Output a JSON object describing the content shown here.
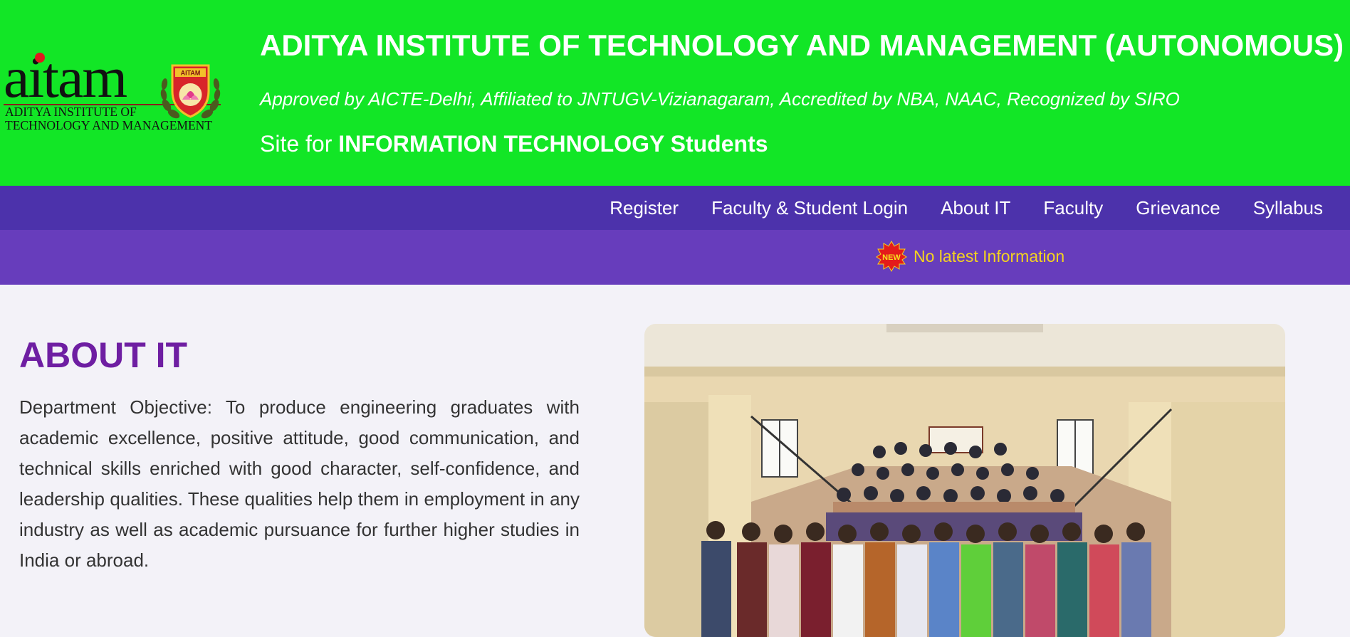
{
  "logo": {
    "wordmark": "aitam",
    "subtitle_line1": "ADITYA INSTITUTE OF",
    "subtitle_line2": "TECHNOLOGY AND MANAGEMENT",
    "emblem_label": "AITAM"
  },
  "header": {
    "title": "ADITYA INSTITUTE OF TECHNOLOGY AND MANAGEMENT (AUTONOMOUS)",
    "approved": "Approved by AICTE-Delhi, Affiliated to JNTUGV-Vizianagaram, Accredited by NBA, NAAC, Recognized by SIRO",
    "site_prefix": "Site for",
    "site_strong": "INFORMATION TECHNOLOGY Students"
  },
  "nav": {
    "items": [
      {
        "label": "Register"
      },
      {
        "label": "Faculty & Student Login"
      },
      {
        "label": "About IT"
      },
      {
        "label": "Faculty"
      },
      {
        "label": "Grievance"
      },
      {
        "label": "Syllabus"
      }
    ]
  },
  "ticker": {
    "badge": "NEW",
    "text": "No latest Information"
  },
  "about": {
    "title": "ABOUT IT",
    "body": "Department Objective: To produce engineering graduates with academic excellence, positive attitude, good communication, and technical skills enriched with good character, self-confidence, and leadership qualities. These qualities help them in employment in any industry as well as academic pursuance for further higher studies in India or abroad."
  },
  "colors": {
    "header_bg": "#12e626",
    "nav_bg": "#4c32ab",
    "ticker_bg": "#673dbc",
    "ticker_text": "#f4d31f",
    "title_purple": "#6e1ea2"
  },
  "icons": {
    "new_badge": "new-badge-icon",
    "emblem": "college-emblem-icon"
  }
}
